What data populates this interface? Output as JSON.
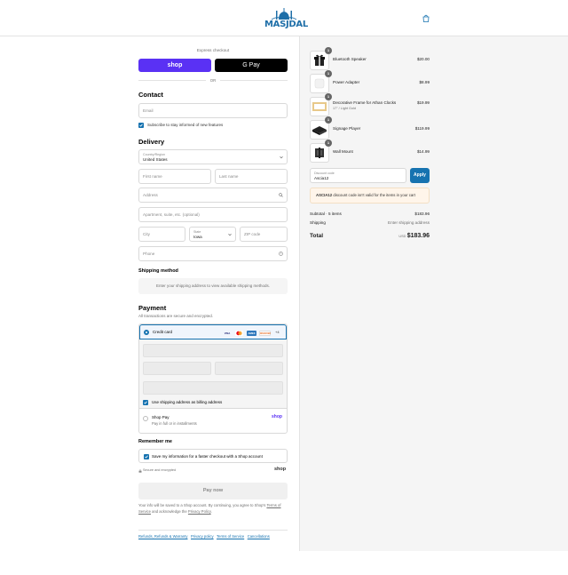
{
  "brand": {
    "name": "MASJDAL",
    "color": "#1f6fa8"
  },
  "header": {
    "cart_icon": "shopping-bag-icon"
  },
  "express": {
    "title": "Express checkout",
    "shop_pay_label": "shop",
    "gpay_label": "G Pay",
    "or_label": "OR"
  },
  "contact": {
    "heading": "Contact",
    "email_placeholder": "Email",
    "subscribe_label": "Subscribe to stay informed of new features"
  },
  "delivery": {
    "heading": "Delivery",
    "country_label": "Country/Region",
    "country_value": "United States",
    "first_name_placeholder": "First name",
    "last_name_placeholder": "Last name",
    "address_placeholder": "Address",
    "apartment_placeholder": "Apartment, suite, etc. (optional)",
    "city_placeholder": "City",
    "state_label": "State",
    "state_value": "Iowa",
    "zip_placeholder": "ZIP code",
    "phone_placeholder": "Phone"
  },
  "shipping": {
    "heading": "Shipping method",
    "message": "Enter your shipping address to view available shipping methods."
  },
  "payment": {
    "heading": "Payment",
    "subtitle": "All transactions are secure and encrypted.",
    "credit_card_label": "Credit card",
    "card_brands": [
      "VISA",
      "MC",
      "AMEX",
      "DISCOVER"
    ],
    "more_cards": "+4",
    "billing_same_label": "Use shipping address as billing address",
    "shop_pay_title": "Shop Pay",
    "shop_pay_sub": "Pay in full or in installments",
    "shop_pay_logo": "shop"
  },
  "remember": {
    "heading": "Remember me",
    "save_label": "Save my information for a faster checkout with a Shop account",
    "secure_label": "Secure and encrypted",
    "shop_logo": "shop"
  },
  "pay_now_label": "Pay now",
  "legal": {
    "text_before": "Your info will be saved to a Shop account. By continuing, you agree to Shop's",
    "terms_link": "Terms of Service",
    "text_middle": "and acknowledge the",
    "privacy_link": "Privacy Policy",
    "text_end": "."
  },
  "footer_links": [
    "Refunds, Refunds & Warranty",
    "Privacy policy",
    "Terms of Service",
    "Cancellations"
  ],
  "order": {
    "items": [
      {
        "name": "Bluetooth Speaker",
        "variant": "",
        "price": "$20.00",
        "qty": "1",
        "thumb": "gift-box-icon"
      },
      {
        "name": "Power Adapter",
        "variant": "",
        "price": "$8.99",
        "qty": "1",
        "thumb": "adapter-icon"
      },
      {
        "name": "Decorative Frame for Athan Clocks",
        "variant": "17\" / Light Gold",
        "price": "$19.99",
        "qty": "1",
        "thumb": "frame-icon"
      },
      {
        "name": "Signage Player",
        "variant": "",
        "price": "$119.99",
        "qty": "1",
        "thumb": "player-icon"
      },
      {
        "name": "Wall Mount",
        "variant": "",
        "price": "$14.99",
        "qty": "1",
        "thumb": "mount-icon"
      }
    ],
    "discount_label": "Discount code",
    "discount_value": "Ascia12",
    "apply_label": "Apply",
    "warning_code": "ASCIA12",
    "warning_text": "discount code isn't valid for the items in your cart",
    "subtotal_label": "Subtotal · 5 items",
    "subtotal_value": "$183.96",
    "shipping_label": "Shipping",
    "shipping_value": "Enter shipping address",
    "total_label": "Total",
    "currency": "USD",
    "total_value": "$183.96"
  }
}
